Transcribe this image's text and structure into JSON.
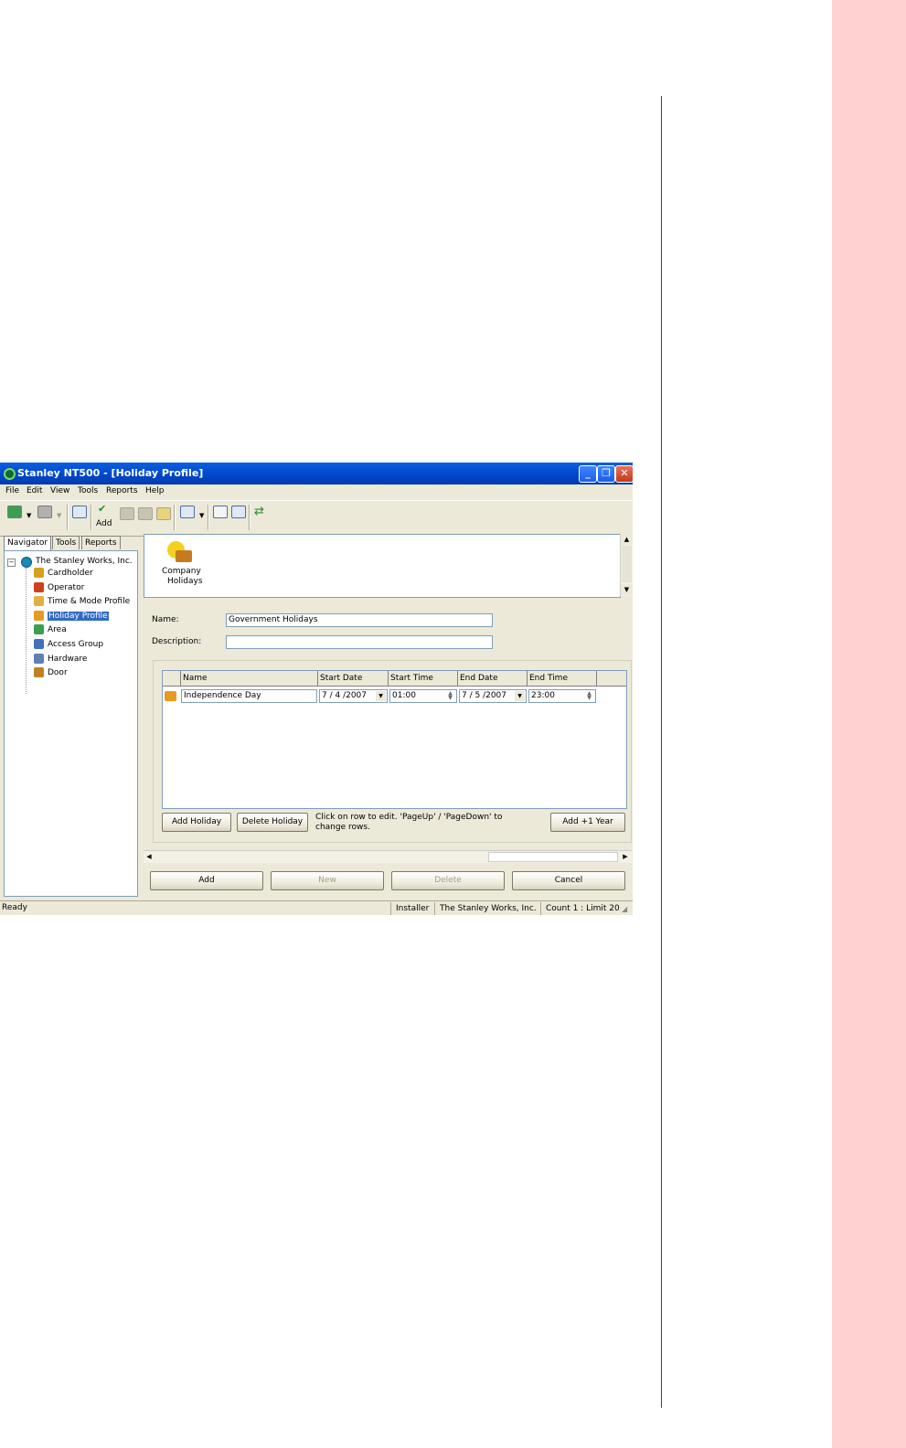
{
  "page": {
    "band_color": "#ffd2d2"
  },
  "window": {
    "title": "Stanley NT500 - [Holiday Profile]",
    "controls": {
      "minimize": "_",
      "restore": "❐",
      "close": "✕"
    }
  },
  "menu": [
    "File",
    "Edit",
    "View",
    "Tools",
    "Reports",
    "Help"
  ],
  "toolbar": {
    "add_label": "Add"
  },
  "tabs": [
    "Navigator",
    "Tools",
    "Reports"
  ],
  "tree": {
    "root": "The Stanley Works, Inc.",
    "items": [
      {
        "label": "Cardholder",
        "icon": "cardholder-icon",
        "color": "#d8a020"
      },
      {
        "label": "Operator",
        "icon": "operator-icon",
        "color": "#d04020"
      },
      {
        "label": "Time & Mode Profile",
        "icon": "clock-icon",
        "color": "#e0b040"
      },
      {
        "label": "Holiday Profile",
        "icon": "holiday-icon",
        "color": "#e89a20"
      },
      {
        "label": "Area",
        "icon": "area-icon",
        "color": "#3aa050"
      },
      {
        "label": "Access Group",
        "icon": "access-group-icon",
        "color": "#4070c0"
      },
      {
        "label": "Hardware",
        "icon": "hardware-icon",
        "color": "#6080b0"
      },
      {
        "label": "Door",
        "icon": "door-icon",
        "color": "#c08020"
      }
    ]
  },
  "icon_pane": {
    "item_label_1": "Company",
    "item_label_2": "Holidays"
  },
  "form": {
    "name_label": "Name:",
    "name_value": "Government Holidays",
    "description_label": "Description:",
    "description_value": ""
  },
  "grid": {
    "headers": [
      "Name",
      "Start Date",
      "Start Time",
      "End Date",
      "End Time"
    ],
    "row": {
      "name": "Independence Day",
      "start_date": "7 / 4 /2007",
      "start_time": "01:00",
      "end_date": "7 / 5 /2007",
      "end_time": "23:00"
    }
  },
  "grid_buttons": {
    "add_holiday": "Add Holiday",
    "delete_holiday": "Delete Holiday",
    "add_year": "Add +1 Year",
    "hint": "Click on row to edit. 'PageUp' / 'PageDown' to change rows."
  },
  "footer_buttons": {
    "add": "Add",
    "new": "New",
    "delete": "Delete",
    "cancel": "Cancel"
  },
  "status": {
    "ready": "Ready",
    "user": "Installer",
    "company": "The Stanley Works, Inc.",
    "count": "Count 1 : Limit 20"
  }
}
